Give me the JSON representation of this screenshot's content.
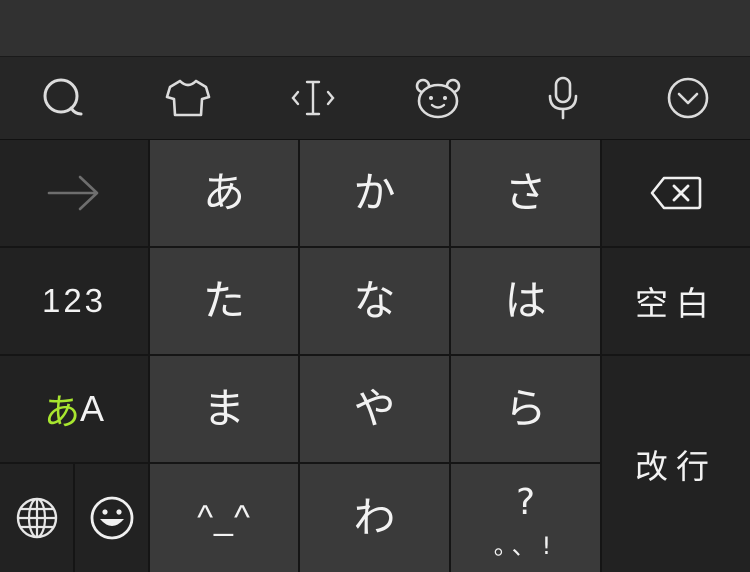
{
  "toolbar": {
    "items": [
      {
        "icon": "search-icon"
      },
      {
        "icon": "theme-shirt-icon"
      },
      {
        "icon": "cursor-move-icon"
      },
      {
        "icon": "emoji-bear-icon"
      },
      {
        "icon": "microphone-icon"
      },
      {
        "icon": "collapse-keyboard-icon"
      }
    ]
  },
  "keyboard": {
    "left": {
      "forward_icon": "arrow-right-icon",
      "numbers_label": "123",
      "mode_kana": "あ",
      "mode_latin": "A",
      "globe_icon": "globe-icon",
      "emoji_icon": "smiley-icon"
    },
    "rows": [
      [
        "あ",
        "か",
        "さ"
      ],
      [
        "た",
        "な",
        "は"
      ],
      [
        "ま",
        "や",
        "ら"
      ]
    ],
    "bottom": {
      "kaomoji": "^_^",
      "wa": "わ",
      "punct_top": "?",
      "punct_bottom": "。、!"
    },
    "right": {
      "delete_icon": "backspace-icon",
      "space_label": "空白",
      "enter_label": "改行"
    }
  },
  "colors": {
    "accent_green": "#a8e62f",
    "key_main": "#3a3a3a",
    "key_side": "#222222",
    "toolbar": "#262626"
  }
}
